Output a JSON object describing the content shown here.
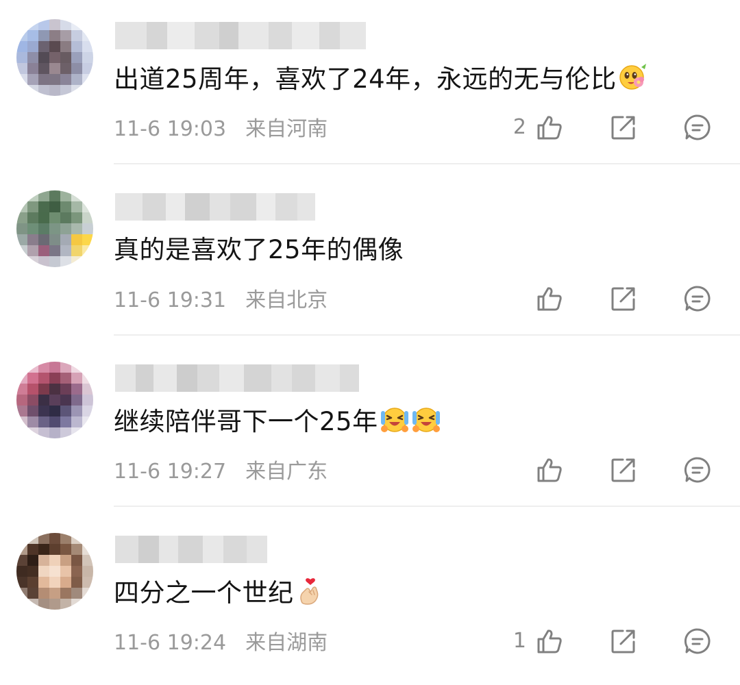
{
  "comments": [
    {
      "text": "出道25周年，喜欢了24年，永远的无与伦比",
      "emoji": "shy-flower-emoji",
      "time": "11-6 19:03",
      "location": "来自河南",
      "likes": "2"
    },
    {
      "text": "真的是喜欢了25年的偶像",
      "time": "11-6 19:31",
      "location": "来自北京",
      "likes": ""
    },
    {
      "text": "继续陪伴哥下一个25年",
      "emoji": "crying-laughing-emoji",
      "time": "11-6 19:27",
      "location": "来自广东",
      "likes": ""
    },
    {
      "text": "四分之一个世纪",
      "emoji": "finger-heart-emoji",
      "time": "11-6 19:24",
      "location": "来自湖南",
      "likes": "1"
    }
  ],
  "icons": {
    "like": "thumbs-up-icon",
    "share": "share-icon",
    "reply": "comment-icon"
  },
  "colors": {
    "text": "#141414",
    "meta": "#9a9a9a",
    "icon": "#808080",
    "divider": "#eeeeee"
  }
}
